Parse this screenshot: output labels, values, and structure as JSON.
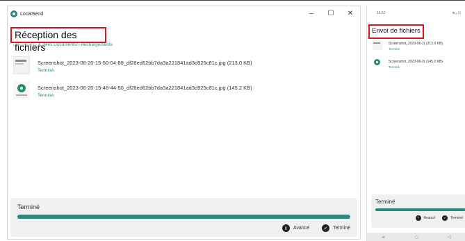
{
  "desktop": {
    "app_name": "LocalSend",
    "window_controls": {
      "minimize": "–",
      "maximize": "☐",
      "close": "✕"
    },
    "page_title": "Réception des fichiers",
    "destination_label": "Destination: ",
    "destination_path": "K:/Mes Documents/Téléchargements",
    "files": [
      {
        "name": "Screenshot_2023-06-20-15-50-04-89_df28ed62bb7da3a221841ad3d925c81c.jpg (213.0 KB)",
        "status": "Terminé"
      },
      {
        "name": "Screenshot_2023-06-20-15-48-44-50_df28ed62bb7da3a221841ad3d925c81c.jpg (145.2 KB)",
        "status": "Terminé"
      }
    ],
    "footer": {
      "status": "Terminé",
      "progress": 1.0,
      "advanced_label": "Avancé",
      "done_label": "Terminé"
    }
  },
  "mobile": {
    "time": "15:52",
    "signal": "⊕ᵤᵢ ⊡",
    "page_title": "Envoi de fichiers",
    "files": [
      {
        "name": "Screenshot_2023-06-2( (213.0 KB)",
        "status": "Terminé"
      },
      {
        "name": "Screenshot_2023-06-2( (145.2 KB)",
        "status": "Terminé"
      }
    ],
    "footer": {
      "status": "Terminé",
      "progress": 1.0,
      "advanced_label": "Avancé",
      "done_label": "Terminé"
    },
    "nav": {
      "menu": "≡",
      "home": "○",
      "back": "◁"
    }
  },
  "colors": {
    "accent": "#2b8a7e",
    "highlight": "#e1141c",
    "footer_bg": "#eef1f0"
  }
}
